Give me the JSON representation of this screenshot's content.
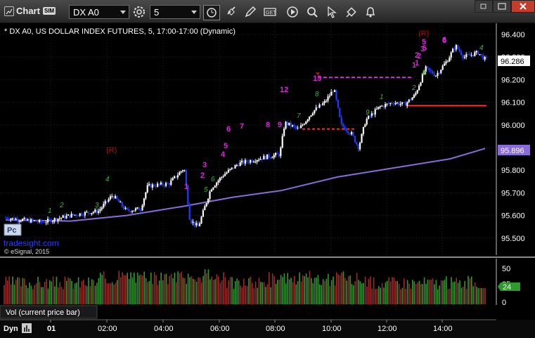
{
  "window": {
    "title": "Chart",
    "badge": "SIM",
    "symbol": "DX A0",
    "interval": "5"
  },
  "chart_data": {
    "type": "candlestick",
    "title": "* DX A0, US DOLLAR INDEX FUTURES, 5, 17:00-17:00 (Dynamic)",
    "price_ticks": [
      "96.400",
      "96.300",
      "96.200",
      "96.100",
      "96.000",
      "95.900",
      "95.800",
      "95.700",
      "95.600",
      "95.500"
    ],
    "time_ticks": [
      "01",
      "02:00",
      "04:00",
      "06:00",
      "08:00",
      "10:00",
      "12:00",
      "14:00"
    ],
    "last_price": "96.286",
    "moving_average_value": "95.896",
    "volume_ticks": [
      "50",
      "25",
      "0"
    ],
    "volume_last": "24",
    "volume_panel_label": "Vol (current price bar)",
    "bottom_left_label": "Dyn",
    "watermark": "tradesight.com",
    "copyright": "© eSignal, 2015",
    "reference_levels": [
      96.21,
      96.085,
      95.982
    ],
    "annotations": {
      "setup_counts": [
        "1",
        "2",
        "3",
        "4",
        "5",
        "6",
        "7",
        "8",
        "9",
        "1",
        "2",
        "3",
        "5",
        "6",
        "12",
        "13",
        "1",
        "2",
        "5",
        "6"
      ],
      "reversal_markers": [
        "(R)",
        "(R)"
      ]
    },
    "ylim": [
      95.45,
      96.45
    ],
    "grid": true
  },
  "colors": {
    "up_bar": "#ffffff",
    "down_bar": "#1f3cff",
    "moving_average": "#8a6cd8",
    "reference_line_magenta": "#cc33cc",
    "reference_line_red": "#ff2a2a",
    "volume_up": "#2e9a2e",
    "volume_down": "#a02a2a",
    "setup_count": "#e020e0",
    "reversal": "#b01010",
    "countdown": "#3cb43c"
  }
}
